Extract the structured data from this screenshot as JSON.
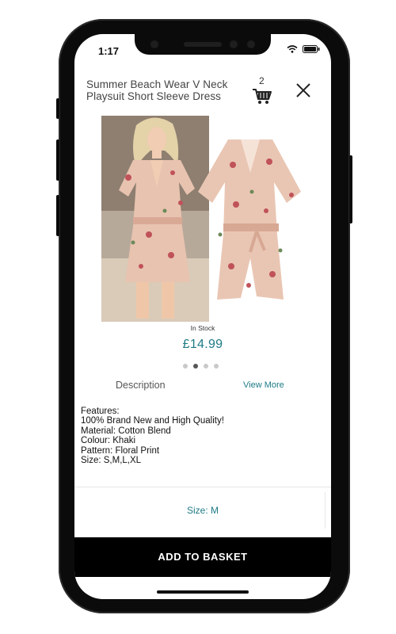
{
  "status_bar": {
    "time": "1:17"
  },
  "header": {
    "title_line1": "Summer Beach Wear V Neck",
    "title_line2": "Playsuit Short Sleeve Dress",
    "cart_count": "2"
  },
  "product": {
    "stock_status": "In Stock",
    "price": "£14.99",
    "carousel": {
      "total": 4,
      "active_index": 1
    },
    "colors": {
      "accent": "#1d7b86",
      "fabric": "#e8c3b0"
    }
  },
  "description": {
    "tab_label": "Description",
    "view_more_label": "View More",
    "features_lines": [
      "Features:",
      "100% Brand New and High Quality!",
      "Material: Cotton Blend",
      "Colour: Khaki",
      "Pattern: Floral Print",
      "Size: S,M,L,XL"
    ]
  },
  "size_selector": {
    "label": "Size: M"
  },
  "actions": {
    "add_to_basket_label": "ADD TO BASKET"
  }
}
